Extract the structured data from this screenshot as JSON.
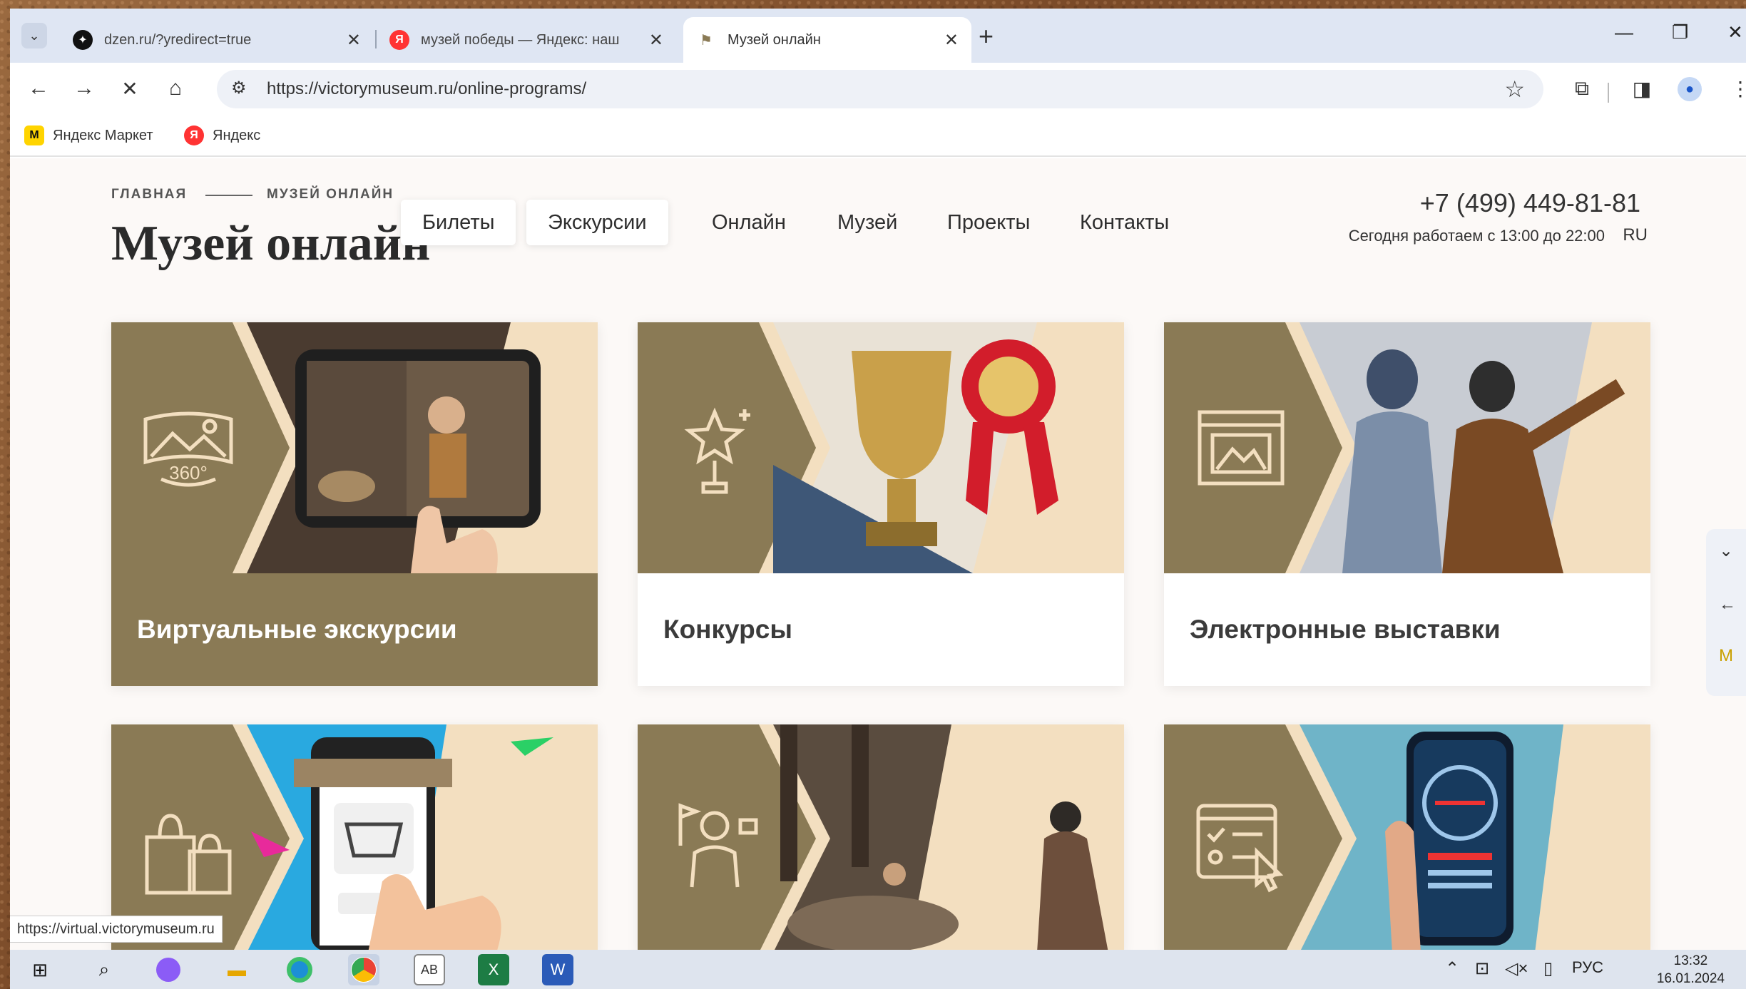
{
  "browser": {
    "tabs": [
      {
        "title": "dzen.ru/?yredirect=true",
        "favicon": "dzen-icon",
        "active": false
      },
      {
        "title": "музей победы — Яндекс: наш",
        "favicon": "yandex-icon",
        "active": false
      },
      {
        "title": "Музей онлайн",
        "favicon": "victory-museum-icon",
        "active": true
      }
    ],
    "new_tab_glyph": "+",
    "url": "https://victorymuseum.ru/online-programs/",
    "bookmarks": [
      {
        "label": "Яндекс Маркет",
        "icon": "yandex-market-icon"
      },
      {
        "label": "Яндекс",
        "icon": "yandex-icon"
      }
    ],
    "status_url": "https://virtual.victorymuseum.ru"
  },
  "site": {
    "breadcrumb": [
      "ГЛАВНАЯ",
      "МУЗЕЙ ОНЛАЙН"
    ],
    "page_title": "Музей онлайн",
    "nav": [
      "Билеты",
      "Экскурсии",
      "Онлайн",
      "Музей",
      "Проекты",
      "Контакты"
    ],
    "phone": "+7 (499) 449-81-81",
    "hours": "Сегодня работаем с 13:00 до 22:00",
    "lang": "RU",
    "cards": [
      {
        "label": "Виртуальные экскурсии",
        "icon": "panorama-360-icon"
      },
      {
        "label": "Конкурсы",
        "icon": "award-star-icon"
      },
      {
        "label": "Электронные выставки",
        "icon": "exhibition-screen-icon"
      },
      {
        "label": "",
        "icon": "shopping-bags-icon"
      },
      {
        "label": "",
        "icon": "guide-person-icon"
      },
      {
        "label": "",
        "icon": "checklist-form-icon"
      }
    ]
  },
  "taskbar": {
    "lang": "РУС",
    "time": "13:32",
    "date": "16.01.2024"
  },
  "colors": {
    "brand_olive": "#8a7a55",
    "cream": "#f3dfc0",
    "page_bg": "#fcf9f7",
    "tabstrip": "#dfe6f3"
  }
}
